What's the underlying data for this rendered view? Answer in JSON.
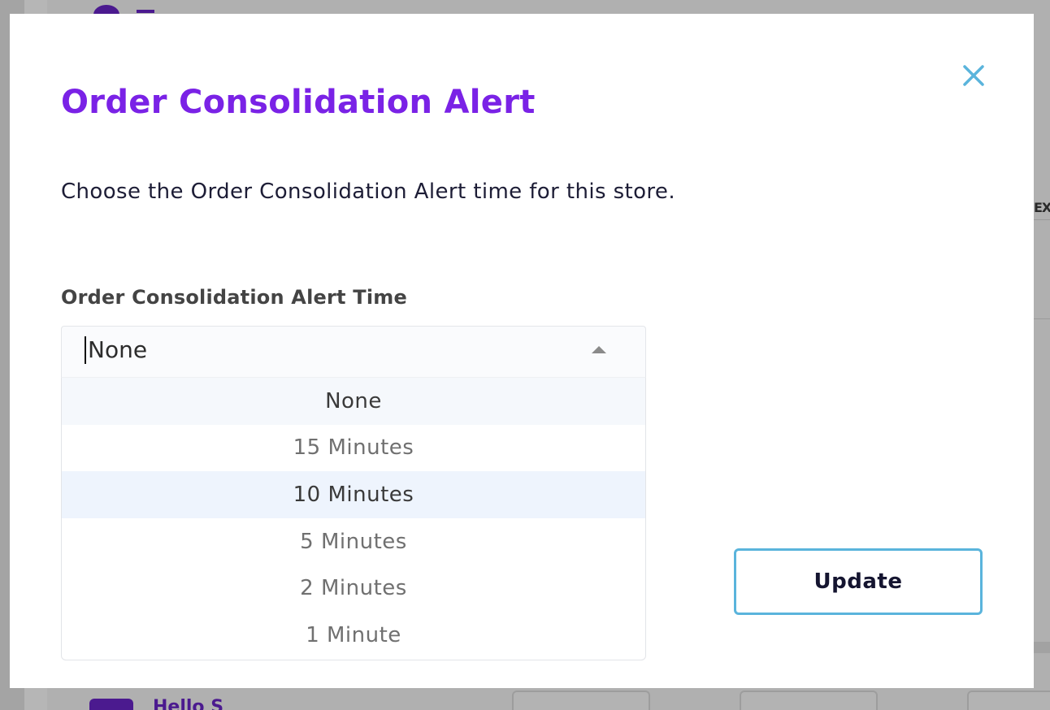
{
  "modal": {
    "title": "Order Consolidation Alert",
    "description": "Choose the Order Consolidation Alert time for this store.",
    "close_icon": "close-icon"
  },
  "alert_time_field": {
    "label": "Order Consolidation Alert Time",
    "selected_value": "None",
    "caret_icon": "caret-up-icon",
    "options": [
      {
        "label": "None",
        "state": "selected"
      },
      {
        "label": "15 Minutes",
        "state": ""
      },
      {
        "label": "10 Minutes",
        "state": "hovered"
      },
      {
        "label": "5 Minutes",
        "state": ""
      },
      {
        "label": "2 Minutes",
        "state": ""
      },
      {
        "label": "1 Minute",
        "state": ""
      }
    ]
  },
  "actions": {
    "update_label": "Update"
  },
  "background": {
    "right_edge_text": "EXI",
    "bottom_text": "Hello S"
  },
  "colors": {
    "title": "#7a22e6",
    "close_icon": "#5ab4dc",
    "button_border": "#5ab4dc",
    "brand_purple": "#4b1a8f"
  }
}
